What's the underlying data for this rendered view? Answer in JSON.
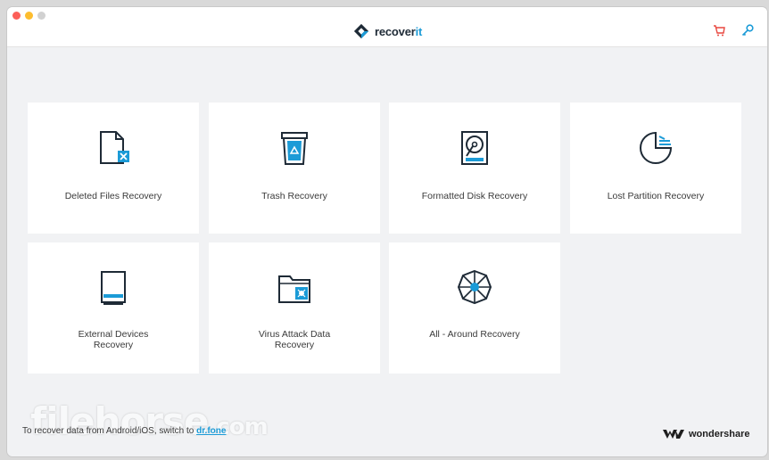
{
  "app": {
    "logo_word": "recover",
    "logo_suffix": "it"
  },
  "toolbar": {
    "cart_icon": "cart-icon",
    "key_icon": "key-icon"
  },
  "cards": [
    {
      "label": "Deleted Files Recovery",
      "icon": "deleted-file-icon"
    },
    {
      "label": "Trash Recovery",
      "icon": "trash-icon"
    },
    {
      "label": "Formatted Disk Recovery",
      "icon": "hard-disk-icon"
    },
    {
      "label": "Lost Partition Recovery",
      "icon": "partition-icon"
    },
    {
      "label_lines": [
        "External Devices",
        "Recovery"
      ],
      "icon": "external-device-icon"
    },
    {
      "label_lines": [
        "Virus Attack Data",
        "Recovery"
      ],
      "icon": "virus-folder-icon"
    },
    {
      "label": "All - Around Recovery",
      "icon": "all-around-icon"
    }
  ],
  "footer": {
    "text": "To recover data from Android/iOS, switch to ",
    "link": "dr.fone"
  },
  "brand": {
    "name": "wondershare"
  },
  "watermark": {
    "main": "filehorse",
    "suffix": ".com"
  },
  "colors": {
    "accent": "#1b9bd7",
    "icon_dark": "#1e2a36",
    "cart": "#e8473f"
  }
}
